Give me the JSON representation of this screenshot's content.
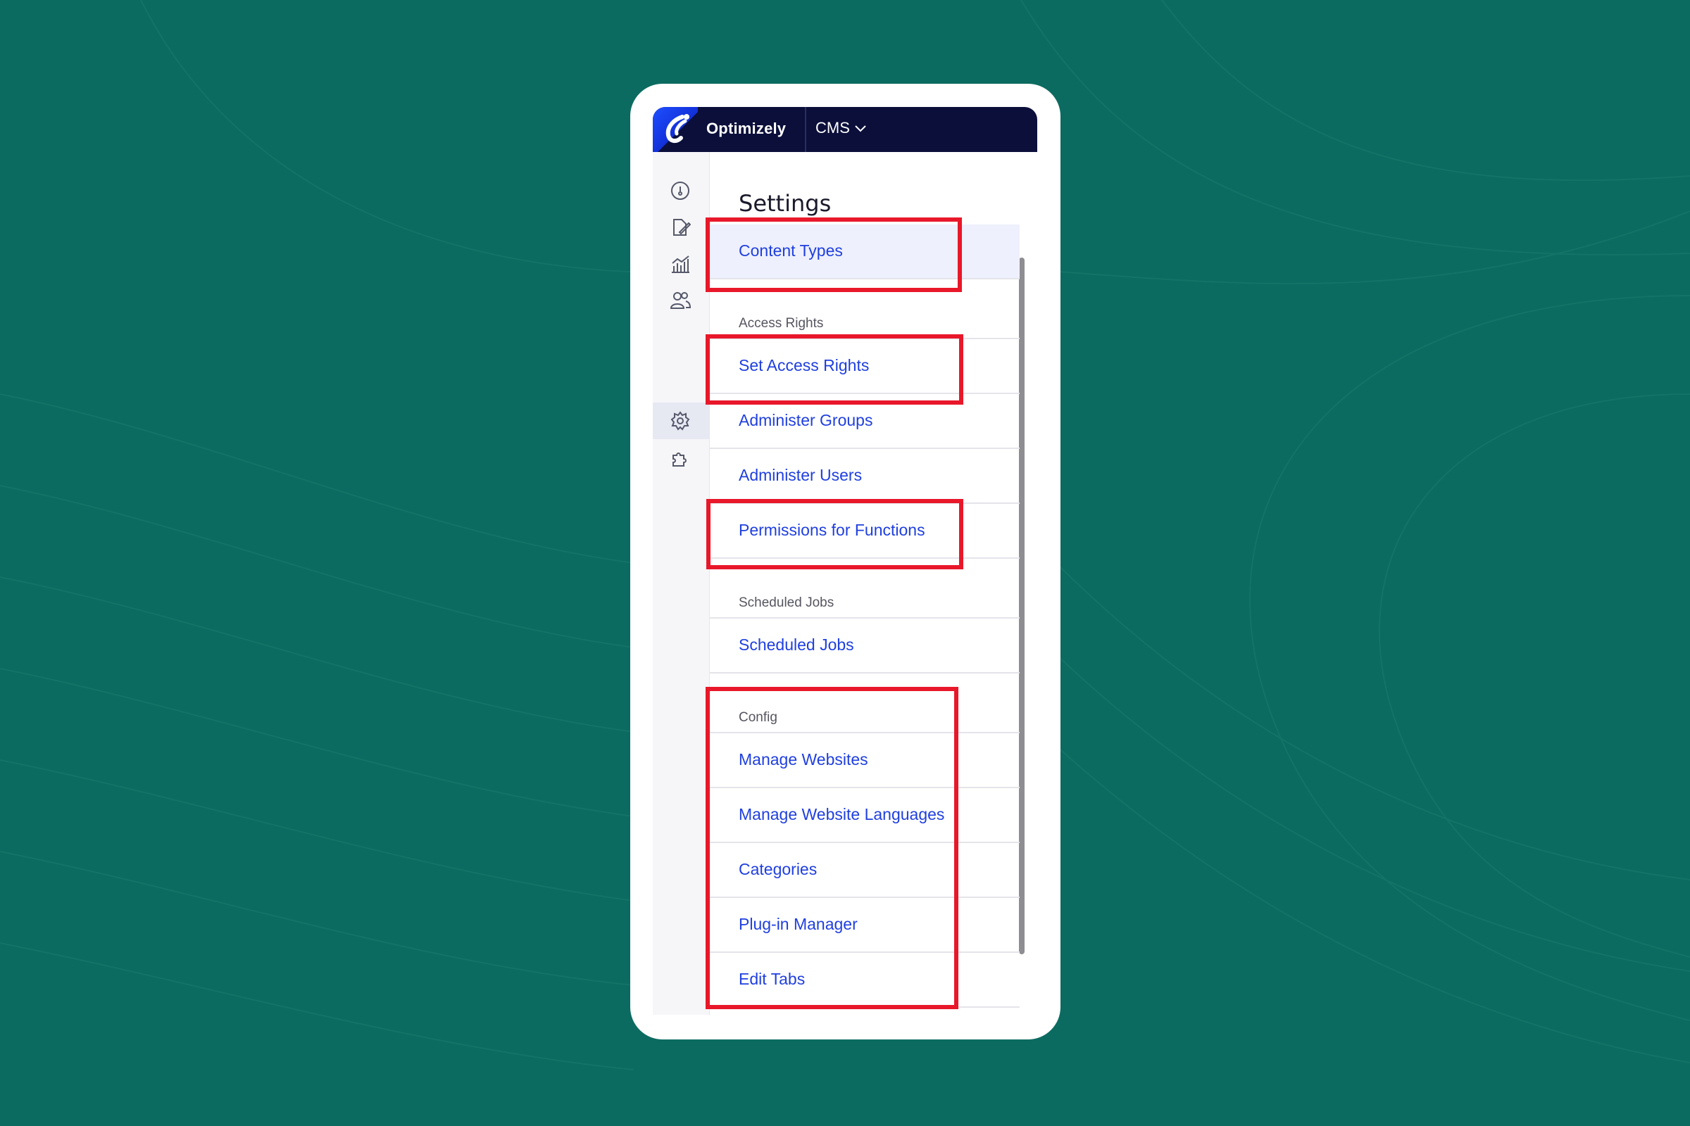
{
  "app": {
    "brand": "Optimizely",
    "product": "CMS"
  },
  "sidebar": {
    "icons": [
      "dashboard-icon",
      "edit-page-icon",
      "analytics-icon",
      "users-icon",
      "settings-icon",
      "addons-icon"
    ],
    "active": "settings-icon"
  },
  "page": {
    "title": "Settings"
  },
  "menu": {
    "content_types": "Content Types",
    "access_rights_header": "Access Rights",
    "set_access_rights": "Set Access Rights",
    "administer_groups": "Administer Groups",
    "administer_users": "Administer Users",
    "permissions_for_functions": "Permissions for Functions",
    "scheduled_jobs_header": "Scheduled Jobs",
    "scheduled_jobs": "Scheduled Jobs",
    "config_header": "Config",
    "manage_websites": "Manage Websites",
    "manage_website_languages": "Manage Website Languages",
    "categories": "Categories",
    "plugin_manager": "Plug-in Manager",
    "edit_tabs": "Edit Tabs"
  },
  "colors": {
    "background": "#0c6b60",
    "topbar": "#0b0f3a",
    "link": "#1f3fe0",
    "highlight": "#e8182a",
    "selected_row": "#eef0fd"
  }
}
